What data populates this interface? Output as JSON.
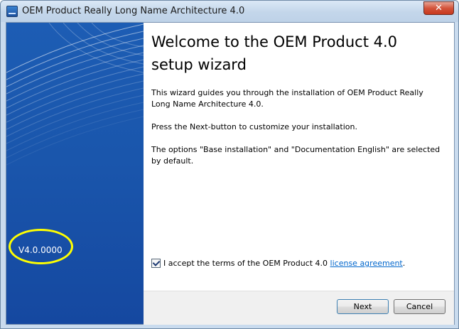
{
  "window": {
    "title": "OEM Product Really Long Name Architecture 4.0",
    "close_glyph": "✕"
  },
  "sidebar": {
    "version": "V4.0.0000",
    "accent_color": "#1d5db4",
    "highlight_color": "#ffff00"
  },
  "main": {
    "heading": "Welcome to the OEM Product 4.0 setup wizard",
    "paragraphs": [
      "This wizard guides you through the installation of OEM Product Really Long Name Architecture 4.0.",
      "Press the Next-button to customize your installation.",
      "The options \"Base installation\" and \"Documentation English\" are selected by default."
    ],
    "accept": {
      "checked": true,
      "label": "I accept the terms of the OEM Product 4.0 ",
      "link_text": "license agreement",
      "suffix": "."
    }
  },
  "footer": {
    "next_label": "Next",
    "cancel_label": "Cancel"
  }
}
